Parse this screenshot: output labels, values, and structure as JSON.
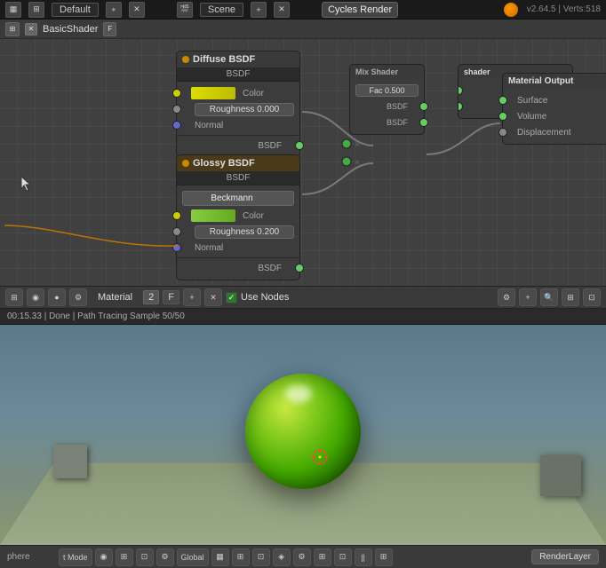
{
  "topbar": {
    "workspace": "Default",
    "scene": "Scene",
    "renderer": "Cycles Render",
    "version": "v2.64.5 | Verts:518",
    "add_btn": "+",
    "close_btn": "✕"
  },
  "node_editor": {
    "title": "BasicShader",
    "f_label": "F",
    "nodes": {
      "diffuse": {
        "title": "Diffuse BSDF",
        "bsdf_label": "BSDF",
        "color_label": "Color",
        "roughness_label": "Roughness 0.000",
        "normal_label": "Normal"
      },
      "glossy": {
        "title": "Glossy BSDF",
        "bsdf_label": "BSDF",
        "distribution": "Beckmann",
        "color_label": "Color",
        "roughness_label": "Roughness 0.200",
        "normal_label": "Normal"
      },
      "mix": {
        "title": "Mix Shader",
        "fac_label": "Fac 0.500",
        "bsdf1_label": "BSDF",
        "bsdf2_label": "BSDF",
        "shader_label": "shader"
      },
      "output": {
        "title": "Material Output",
        "surface_label": "Surface",
        "volume_label": "Volume",
        "displacement_label": "Displacement"
      }
    }
  },
  "material_toolbar": {
    "material_label": "Material",
    "num": "2",
    "f_label": "F",
    "use_nodes_label": "Use Nodes"
  },
  "status_bar": {
    "text": "00:15.33 | Done | Path Tracing Sample 50/50"
  },
  "bottom_bar": {
    "mode_label": "t Mode",
    "global_label": "Global",
    "render_layer": "RenderLayer",
    "sphere_label": "phere"
  },
  "icons": {
    "grid": "▦",
    "camera": "📷",
    "sphere": "◉",
    "plus": "+",
    "cross": "✕",
    "check": "✓",
    "arrow": "▾",
    "left": "◂",
    "right": "▸"
  }
}
